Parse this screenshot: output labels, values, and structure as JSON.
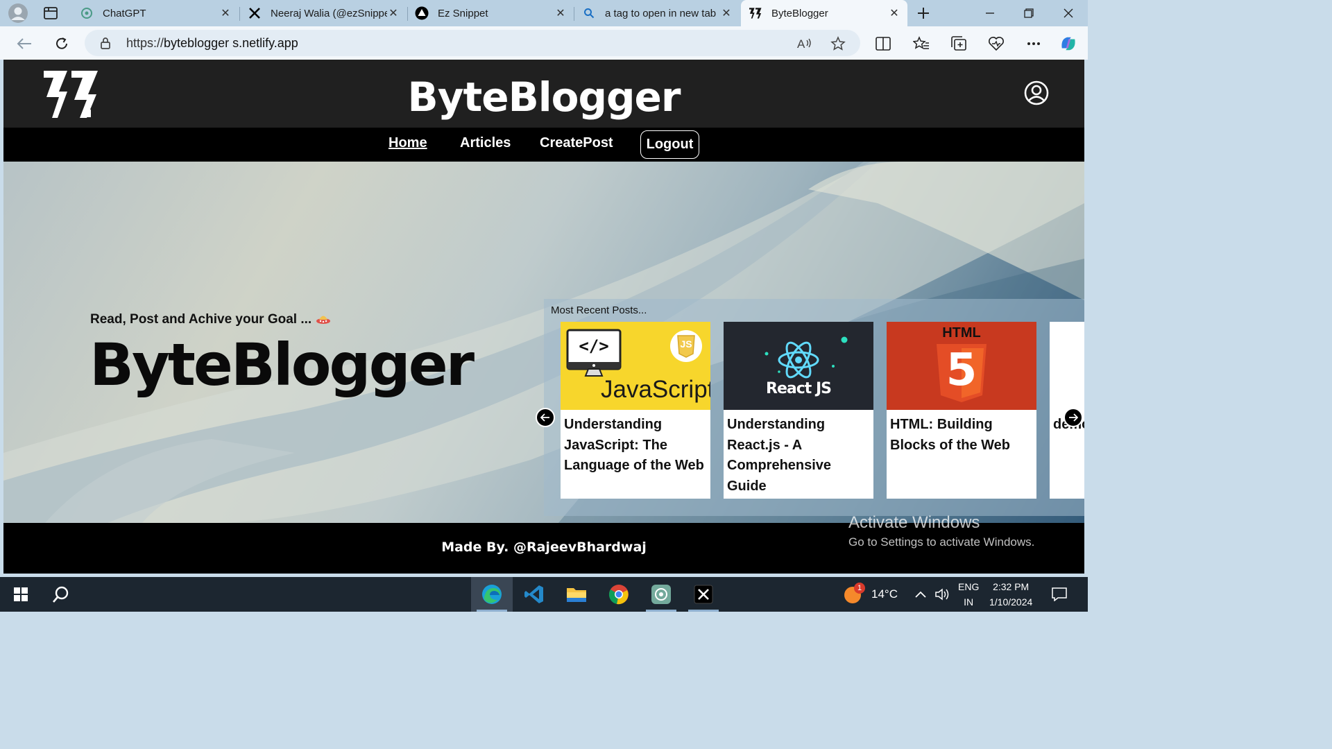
{
  "browser": {
    "tabs": [
      {
        "title": "ChatGPT",
        "icon": "chatgpt-icon"
      },
      {
        "title": "Neeraj Walia (@ezSnippe",
        "icon": "x-logo-icon"
      },
      {
        "title": "Ez Snippet",
        "icon": "triangle-logo-icon"
      },
      {
        "title": "a tag to open in new tab",
        "icon": "search-icon"
      },
      {
        "title": "ByteBlogger",
        "icon": "byteblogger-logo-icon",
        "active": true
      }
    ],
    "url_scheme": "https://",
    "url_host": "byteblogger s.netlify.app"
  },
  "site": {
    "title": "ByteBlogger",
    "nav": {
      "home": "Home",
      "articles": "Articles",
      "create": "CreatePost",
      "logout": "Logout"
    },
    "hero": {
      "tagline": "Read, Post and Achive your Goal ...",
      "title": "ByteBlogger"
    },
    "recent": {
      "label": "Most Recent Posts...",
      "cards": [
        {
          "title": "Understanding JavaScript: The Language of the Web",
          "thumb_text": "JavaScript",
          "thumb_badge": "JS"
        },
        {
          "title": "Understanding React.js - A Comprehensive Guide",
          "thumb_text": "React JS"
        },
        {
          "title": "HTML: Building Blocks of the Web",
          "thumb_text": "HTML",
          "thumb_number": "5"
        },
        {
          "title": "demo"
        }
      ]
    },
    "footer": "Made By. @RajeevBhardwaj"
  },
  "watermark": {
    "line1": "Activate Windows",
    "line2": "Go to Settings to activate Windows."
  },
  "taskbar": {
    "weather": "14°C",
    "notification_count": "1",
    "lang1": "ENG",
    "lang2": "IN",
    "time": "2:32 PM",
    "date": "1/10/2024"
  },
  "colors": {
    "js_yellow": "#f7d62c",
    "react_bg": "#23272f",
    "react_cyan": "#61dafb",
    "html_orange": "#e44d26",
    "header_bg": "#202020",
    "nav_bg": "#000000"
  }
}
